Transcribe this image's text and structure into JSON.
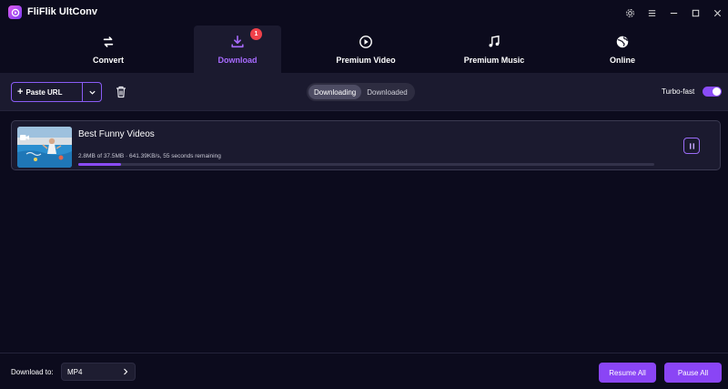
{
  "app": {
    "title": "FliFlik UltConv"
  },
  "window_controls": [
    "gear-icon",
    "menu-icon",
    "minimize-icon",
    "maximize-icon",
    "close-icon"
  ],
  "tabs": [
    {
      "label": "Convert",
      "icon": "convert-arrows-icon",
      "active": false
    },
    {
      "label": "Download",
      "icon": "download-icon",
      "active": true,
      "badge": "1"
    },
    {
      "label": "Premium Video",
      "icon": "play-circle-icon",
      "active": false
    },
    {
      "label": "Premium Music",
      "icon": "music-note-icon",
      "active": false
    },
    {
      "label": "Online",
      "icon": "globe-icon",
      "active": false
    }
  ],
  "toolbar": {
    "paste_url": "Paste URL",
    "segments": [
      "Downloading",
      "Downloaded"
    ],
    "active_segment": "Downloading",
    "turbo_label": "Turbo-fast",
    "turbo_on": true
  },
  "downloads": [
    {
      "title": "Best Funny Videos",
      "progress_text": "2.8MB of 37.5MB ·  641.39KB/s, 55 seconds remaining",
      "progress_fraction": 0.075
    }
  ],
  "footer": {
    "download_to_label": "Download to:",
    "format": "MP4",
    "resume_all": "Resume All",
    "pause_all": "Pause All"
  },
  "colors": {
    "accent": "#8a45f5",
    "background": "#0c0b1d",
    "panel": "#1b1a2f",
    "badge": "#f0414a"
  }
}
